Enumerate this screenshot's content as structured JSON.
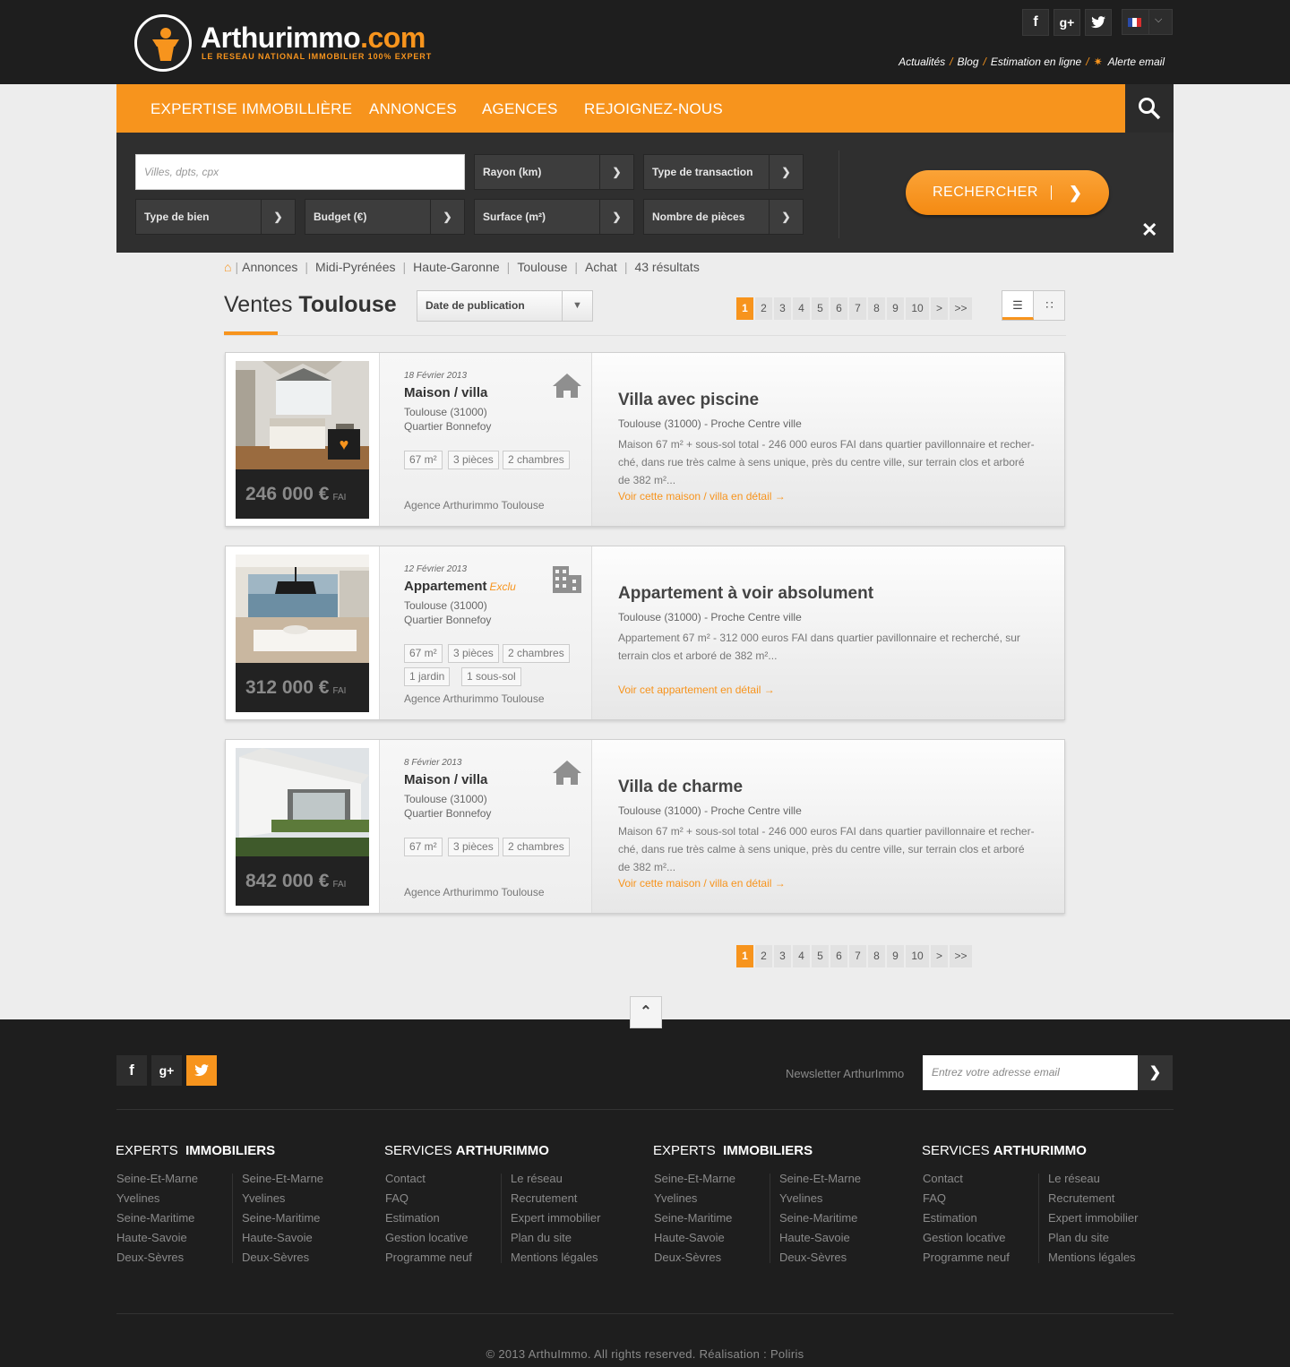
{
  "brand": {
    "name_main": "Arthurimmo",
    "name_ext": ".com",
    "tagline": "LE RESEAU NATIONAL IMMOBILIER 100% EXPERT",
    "accent": "#f7941d"
  },
  "social_top": {
    "facebook": "f",
    "googleplus": "g+",
    "twitter": "twitter-icon"
  },
  "top_links": [
    "Actualités",
    "Blog",
    "Estimation en ligne",
    "Alerte email"
  ],
  "nav": [
    "EXPERTISE IMMOBILLIÈRE",
    "ANNONCES",
    "AGENCES",
    "REJOIGNEZ-NOUS"
  ],
  "search": {
    "city_placeholder": "Villes, dpts, cpx",
    "rayon": "Rayon (km)",
    "transaction": "Type de transaction",
    "bien": "Type de bien",
    "budget": "Budget (€)",
    "surface": "Surface (m²)",
    "pieces": "Nombre de pièces",
    "button": "RECHERCHER"
  },
  "breadcrumb": [
    "Annonces",
    "Midi-Pyrénées",
    "Haute-Garonne",
    "Toulouse",
    "Achat",
    "43 résultats"
  ],
  "heading": {
    "prefix": "Ventes",
    "city": "Toulouse"
  },
  "sort": "Date de publication",
  "pagination": [
    "1",
    "2",
    "3",
    "4",
    "5",
    "6",
    "7",
    "8",
    "9",
    "10",
    ">",
    ">>"
  ],
  "listings": [
    {
      "date": "18 Février 2013",
      "type": "Maison / villa",
      "exclu": "",
      "city": "Toulouse (31000)",
      "district": "Quartier Bonnefoy",
      "tags": [
        "67 m²",
        "3 pièces",
        "2 chambres"
      ],
      "agency": "Agence Arthurimmo Toulouse",
      "price": "246 000 €",
      "price_suffix": "FAI",
      "title": "Villa avec piscine",
      "subtitle": "Toulouse (31000) - Proche Centre ville",
      "desc": "Maison 67 m² + sous-sol total - 246 000 euros FAI dans quartier pavillonnaire et recher-ché, dans rue très calme à sens unique, près du centre ville, sur terrain clos et arboré de 382 m²...",
      "link": "Voir cette maison / villa en détail →",
      "icon": "house-icon"
    },
    {
      "date": "12 Février 2013",
      "type": "Appartement",
      "exclu": "Exclu",
      "city": "Toulouse (31000)",
      "district": "Quartier Bonnefoy",
      "tags": [
        "67 m²",
        "3 pièces",
        "2 chambres",
        "1 jardin",
        "1 sous-sol"
      ],
      "agency": "Agence Arthurimmo Toulouse",
      "price": "312 000 €",
      "price_suffix": "FAI",
      "title": "Appartement à voir absolument",
      "subtitle": "Toulouse (31000) - Proche Centre ville",
      "desc": "Appartement 67 m² - 312 000 euros FAI dans quartier pavillonnaire et recherché, sur terrain clos et arboré de 382 m²...",
      "link": "Voir cet appartement en détail →",
      "icon": "building-icon"
    },
    {
      "date": "8 Février 2013",
      "type": "Maison / villa",
      "exclu": "",
      "city": "Toulouse (31000)",
      "district": "Quartier Bonnefoy",
      "tags": [
        "67 m²",
        "3 pièces",
        "2 chambres"
      ],
      "agency": "Agence Arthurimmo Toulouse",
      "price": "842 000 €",
      "price_suffix": "FAI",
      "title": "Villa de charme",
      "subtitle": "Toulouse (31000) - Proche Centre ville",
      "desc": "Maison 67 m² + sous-sol total - 246 000 euros FAI dans quartier pavillonnaire et recher-ché, dans rue très calme à sens unique, près du centre ville, sur terrain clos et arboré de 382 m²...",
      "link": "Voir cette maison / villa en détail →",
      "icon": "house-icon"
    }
  ],
  "footer": {
    "newsletter_label": "Newsletter ArthurImmo",
    "newsletter_placeholder": "Entrez votre adresse email",
    "h_experts_1": "EXPERTS",
    "h_experts_2": "IMMOBILIERS",
    "h_services_1": "SERVICES",
    "h_services_2": "ARTHURIMMO",
    "regions": [
      "Seine-Et-Marne",
      "Yvelines",
      "Seine-Maritime",
      "Haute-Savoie",
      "Deux-Sèvres"
    ],
    "services_a": [
      "Contact",
      "FAQ",
      "Estimation",
      "Gestion locative",
      "Programme neuf"
    ],
    "services_b": [
      "Le réseau",
      "Recrutement",
      "Expert immobilier",
      "Plan du site",
      "Mentions légales"
    ],
    "copyright": "© 2013 ArthuImmo. All rights reserved. Réalisation : Poliris"
  }
}
